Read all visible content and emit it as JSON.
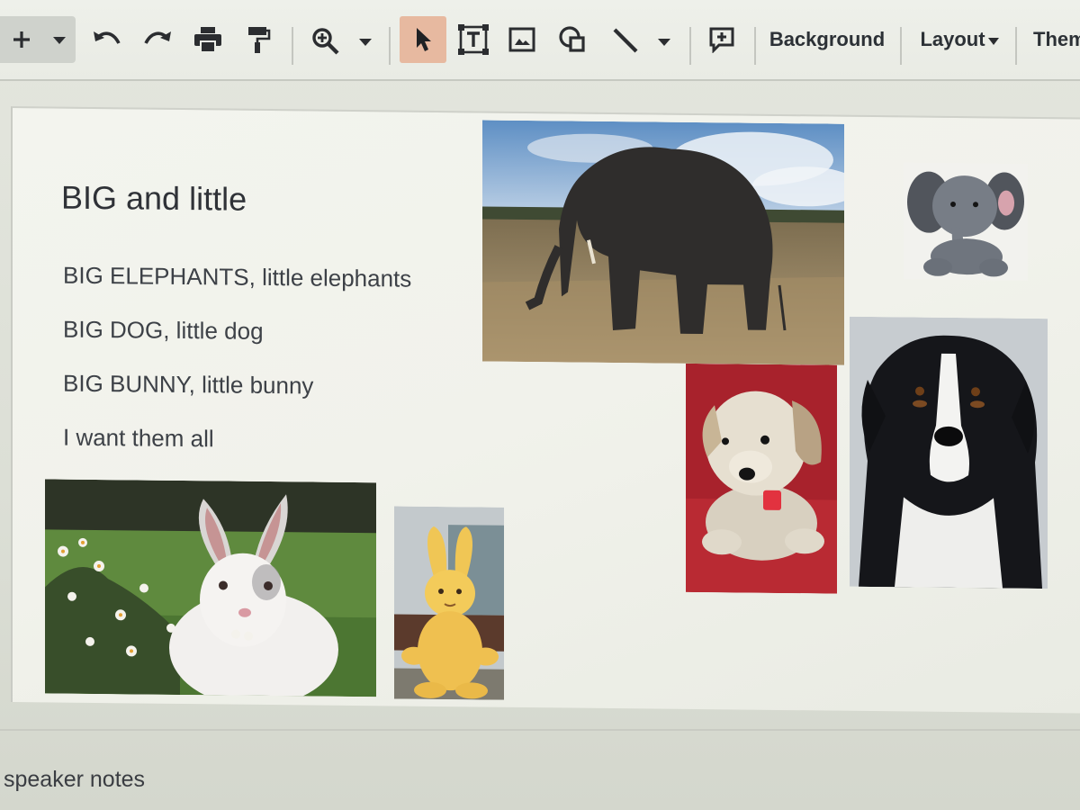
{
  "toolbar": {
    "new_slide_icon": "plus-icon",
    "background_label": "Background",
    "layout_label": "Layout",
    "theme_label": "Them"
  },
  "slide": {
    "title": "BIG and little",
    "body": [
      "BIG ELEPHANTS, little elephants",
      "BIG DOG, little dog",
      "BIG BUNNY, little bunny",
      "I want them all"
    ]
  },
  "notes": {
    "label": "speaker notes"
  },
  "colors": {
    "select_tool_highlight": "#e7b9a0",
    "slide_background": "#f2f3ed",
    "toolbar_background": "#ebede6"
  }
}
